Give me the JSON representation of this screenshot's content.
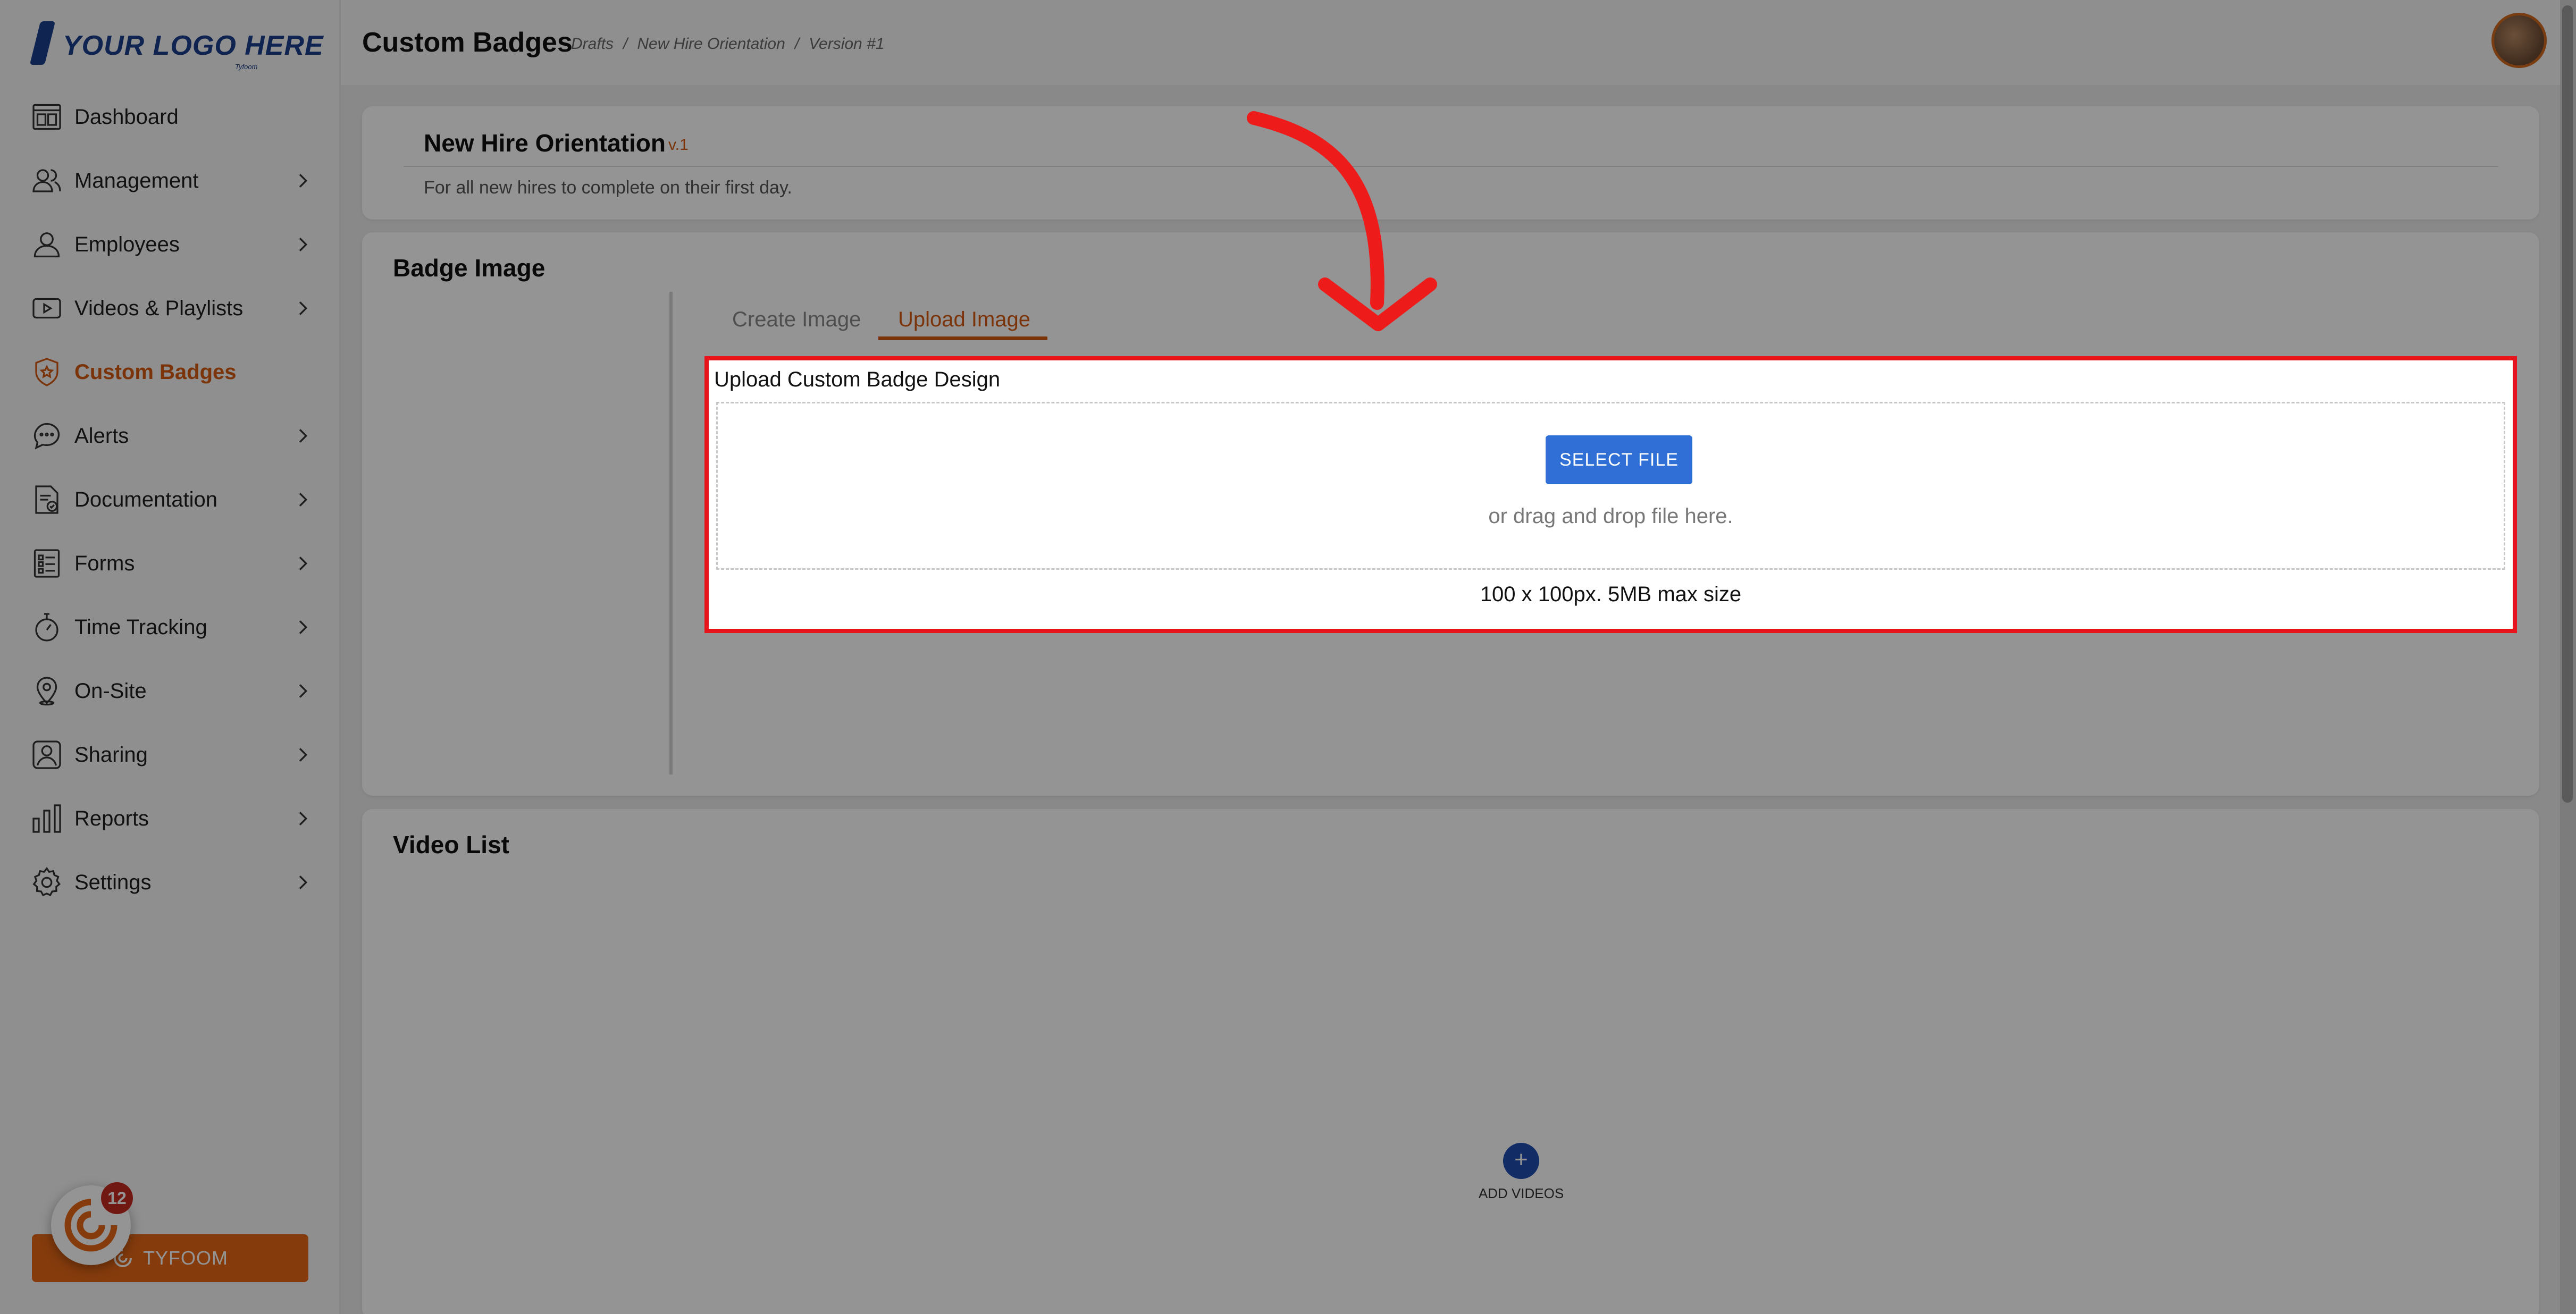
{
  "brand": {
    "logo_text": "YOUR LOGO HERE",
    "logo_sub": "Tyfoom"
  },
  "sidebar": {
    "items": [
      {
        "label": "Dashboard",
        "icon": "dashboard-icon",
        "has_chevron": false
      },
      {
        "label": "Management",
        "icon": "management-icon",
        "has_chevron": true
      },
      {
        "label": "Employees",
        "icon": "employee-icon",
        "has_chevron": true
      },
      {
        "label": "Videos & Playlists",
        "icon": "video-icon",
        "has_chevron": true
      },
      {
        "label": "Custom Badges",
        "icon": "badge-icon",
        "has_chevron": false,
        "active": true
      },
      {
        "label": "Alerts",
        "icon": "alert-icon",
        "has_chevron": true
      },
      {
        "label": "Documentation",
        "icon": "documentation-icon",
        "has_chevron": true
      },
      {
        "label": "Forms",
        "icon": "forms-icon",
        "has_chevron": true
      },
      {
        "label": "Time Tracking",
        "icon": "stopwatch-icon",
        "has_chevron": true
      },
      {
        "label": "On-Site",
        "icon": "location-pin-icon",
        "has_chevron": true
      },
      {
        "label": "Sharing",
        "icon": "sharing-icon",
        "has_chevron": true
      },
      {
        "label": "Reports",
        "icon": "reports-icon",
        "has_chevron": true
      },
      {
        "label": "Settings",
        "icon": "gear-icon",
        "has_chevron": true
      }
    ],
    "tyfoom_button": "TYFOOM",
    "notification_count": "12"
  },
  "header": {
    "title": "Custom Badges",
    "breadcrumb": [
      "Drafts",
      "/",
      "New Hire Orientation",
      "/",
      "Version #1"
    ]
  },
  "info_card": {
    "title": "New Hire Orientation",
    "version": "v.1",
    "description": "For all new hires to complete on their first day."
  },
  "badge_image": {
    "title": "Badge Image",
    "tabs": [
      {
        "label": "Create Image",
        "active": false
      },
      {
        "label": "Upload Image",
        "active": true
      }
    ],
    "upload": {
      "heading": "Upload Custom Badge Design",
      "select_button": "SELECT FILE",
      "drop_text": "or drag and drop file here.",
      "size_note": "100 x 100px. 5MB max size"
    }
  },
  "video_list": {
    "title": "Video List",
    "add_label": "ADD VIDEOS"
  },
  "colors": {
    "accent": "#d55a12",
    "primary_button": "#2f6fd6",
    "highlight": "#e8141b"
  }
}
